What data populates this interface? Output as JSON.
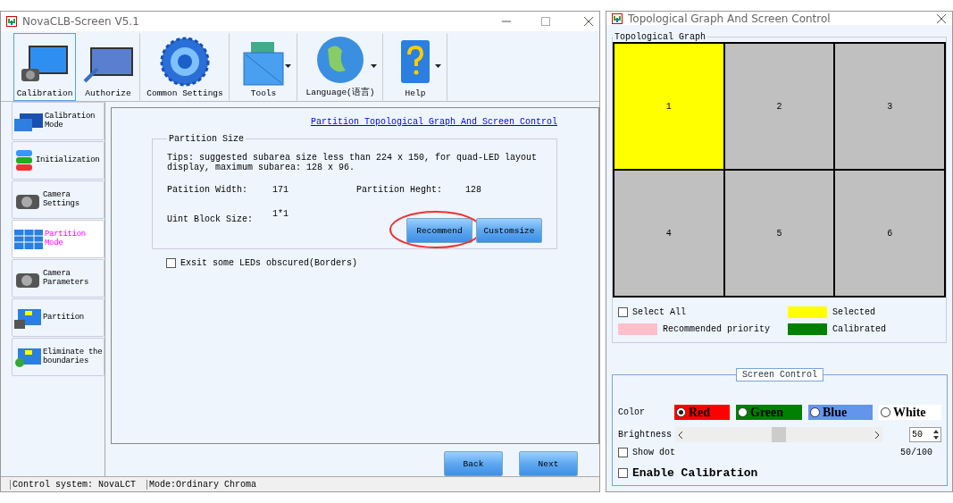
{
  "main_window": {
    "title": "NovaCLB-Screen V5.1"
  },
  "toolbar": [
    {
      "label": "Calibration",
      "kind": "calibration",
      "selected": true,
      "has_menu": false
    },
    {
      "label": "Authorize",
      "kind": "authorize",
      "selected": false,
      "has_menu": false
    },
    {
      "label": "Common Settings",
      "kind": "settings",
      "selected": false,
      "has_menu": false
    },
    {
      "label": "Tools",
      "kind": "tools",
      "selected": false,
      "has_menu": true
    },
    {
      "label": "Language(语言)",
      "kind": "language",
      "selected": false,
      "has_menu": true
    },
    {
      "label": "Help",
      "kind": "help",
      "selected": false,
      "has_menu": true
    }
  ],
  "sidebar": [
    {
      "label": "Calibration\nMode",
      "kind": "screen",
      "selected": false
    },
    {
      "label": "Initialization",
      "kind": "stack",
      "selected": false
    },
    {
      "label": "Camera\nSettings",
      "kind": "camera",
      "selected": false
    },
    {
      "label": "Partition\nMode",
      "kind": "grid",
      "selected": true
    },
    {
      "label": "Camera\nParameters",
      "kind": "camera",
      "selected": false
    },
    {
      "label": "Partition",
      "kind": "partition",
      "selected": false
    },
    {
      "label": "Eliminate the\nboundaries",
      "kind": "eliminate",
      "selected": false
    }
  ],
  "link": "Partition Topological Graph And Screen Control",
  "partition_size": {
    "title": "Partition Size",
    "tips": "Tips: suggested subarea size less than 224 x 150, for quad-LED layout display, maximum subarea: 128 x 96.",
    "width_label": "Patition Width:",
    "width_value": "171",
    "height_label": "Partition Heght:",
    "height_value": "128",
    "block_label": "Uint Block Size:",
    "block_value": "1*1",
    "buttons": [
      {
        "label": "Recommend",
        "circled": true
      },
      {
        "label": "Customsize",
        "circled": false
      }
    ]
  },
  "borders_checkbox": {
    "label": "Exsit some LEDs obscured(Borders)",
    "checked": false
  },
  "nav_buttons": [
    "Back",
    "Next"
  ],
  "status_bar": [
    "Control system: NovaLCT",
    "Mode:Ordinary Chroma"
  ],
  "topo_window": {
    "title": "Topological Graph And Screen Control"
  },
  "topological_graph": {
    "title": "Topological Graph",
    "cells": [
      {
        "label": "1",
        "selected": true
      },
      {
        "label": "2",
        "selected": false
      },
      {
        "label": "3",
        "selected": false
      },
      {
        "label": "4",
        "selected": false
      },
      {
        "label": "5",
        "selected": false
      },
      {
        "label": "6",
        "selected": false
      }
    ],
    "select_all": {
      "label": "Select All",
      "checked": false
    },
    "legend": [
      {
        "label": "Selected",
        "color": "#ffff00"
      },
      {
        "label": "Recommended priority",
        "color": "#ffc0cb"
      },
      {
        "label": "Calibrated",
        "color": "#008000"
      }
    ]
  },
  "screen_control": {
    "title": "Screen Control",
    "color_label": "Color",
    "colors": [
      {
        "label": "Red",
        "color": "#ff0000",
        "selected": true
      },
      {
        "label": "Green",
        "color": "#008000",
        "selected": false
      },
      {
        "label": "Blue",
        "color": "#6495ed",
        "selected": false
      },
      {
        "label": "White",
        "color": "#ffffff",
        "selected": false
      }
    ],
    "brightness_label": "Brightness",
    "brightness": {
      "level": 0.5,
      "value": "50",
      "reading": "50/100"
    },
    "show_dot": {
      "label": "Show dot",
      "checked": false
    },
    "enable_calibration": {
      "label": "Enable Calibration",
      "checked": false
    }
  }
}
